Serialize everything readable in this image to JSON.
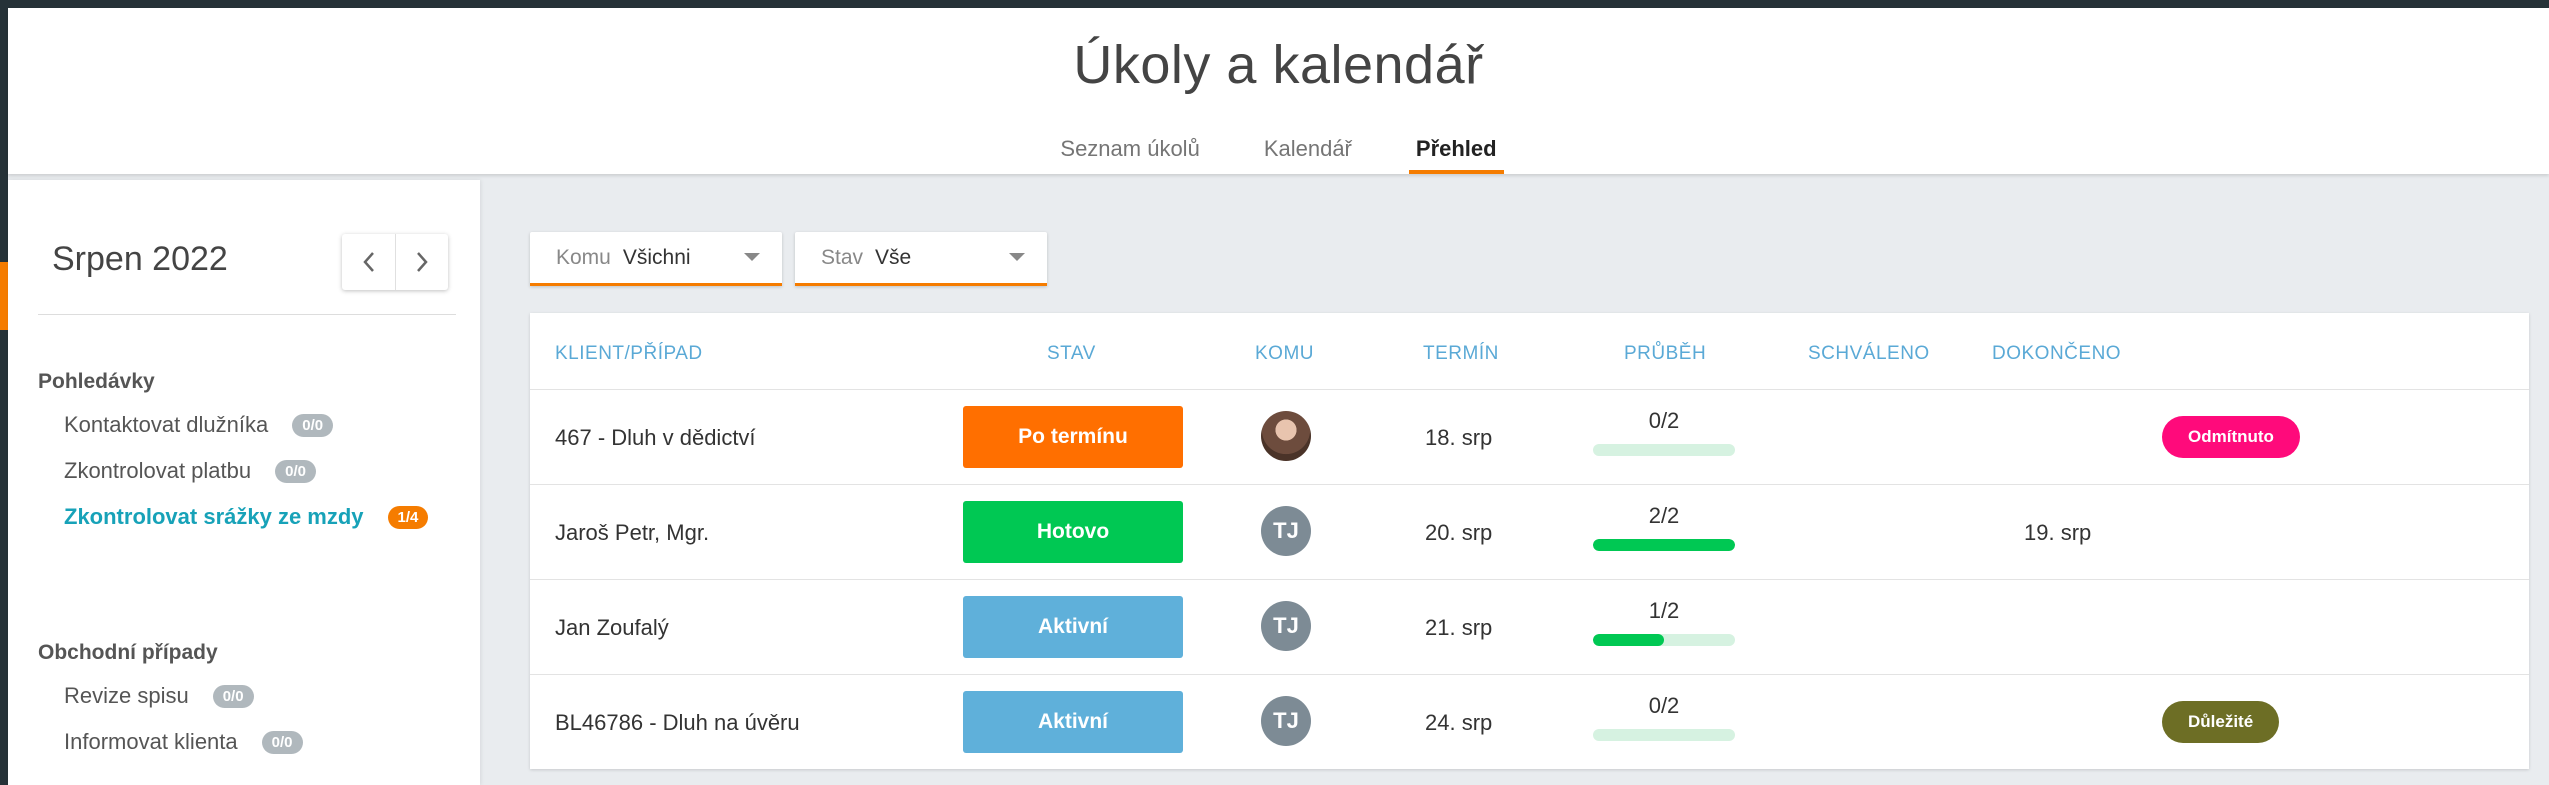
{
  "header": {
    "title": "Úkoly a kalendář",
    "tabs": [
      {
        "label": "Seznam úkolů"
      },
      {
        "label": "Kalendář"
      },
      {
        "label": "Přehled"
      }
    ]
  },
  "sidebar": {
    "month": "Srpen 2022",
    "sections": [
      {
        "heading": "Pohledávky",
        "items": [
          {
            "label": "Kontaktovat dlužníka",
            "count": "0/0"
          },
          {
            "label": "Zkontrolovat platbu",
            "count": "0/0"
          },
          {
            "label": "Zkontrolovat srážky ze mzdy",
            "count": "1/4"
          }
        ]
      },
      {
        "heading": "Obchodní případy",
        "items": [
          {
            "label": "Revize spisu",
            "count": "0/0"
          },
          {
            "label": "Informovat klienta",
            "count": "0/0"
          }
        ]
      }
    ]
  },
  "filters": {
    "komu": {
      "label": "Komu",
      "value": "Všichni"
    },
    "stav": {
      "label": "Stav",
      "value": "Vše"
    }
  },
  "table": {
    "columns": [
      "KLIENT/PŘÍPAD",
      "STAV",
      "KOMU",
      "TERMÍN",
      "PRŮBĚH",
      "SCHVÁLENO",
      "DOKONČENO"
    ],
    "rows": [
      {
        "client": "467 - Dluh v dědictví",
        "status": "Po termínu",
        "status_color": "#ff6f00",
        "assignee": "",
        "term": "18. srp",
        "progress_text": "0/2",
        "progress": 0.0,
        "approved": "",
        "done": "",
        "tag": "Odmítnuto",
        "tag_color": "#ff0a7b"
      },
      {
        "client": "Jaroš Petr, Mgr.",
        "status": "Hotovo",
        "status_color": "#00c853",
        "assignee": "TJ",
        "term": "20. srp",
        "progress_text": "2/2",
        "progress": 1.0,
        "approved": "",
        "done": "19. srp",
        "tag": "",
        "tag_color": ""
      },
      {
        "client": "Jan Zoufalý",
        "status": "Aktivní",
        "status_color": "#5fb0da",
        "assignee": "TJ",
        "term": "21. srp",
        "progress_text": "1/2",
        "progress": 0.5,
        "approved": "",
        "done": "",
        "tag": "",
        "tag_color": ""
      },
      {
        "client": "BL46786 - Dluh na úvěru",
        "status": "Aktivní",
        "status_color": "#5fb0da",
        "assignee": "TJ",
        "term": "24. srp",
        "progress_text": "0/2",
        "progress": 0.0,
        "approved": "",
        "done": "",
        "tag": "Důležité",
        "tag_color": "#6d6e25"
      }
    ]
  },
  "colors": {
    "accent": "#f57c00",
    "header_text": "#5aa9d6",
    "active_link": "#17a2b8"
  },
  "icons": {
    "prev": "chevron-left-icon",
    "next": "chevron-right-icon",
    "dropdown": "caret-down-icon"
  }
}
